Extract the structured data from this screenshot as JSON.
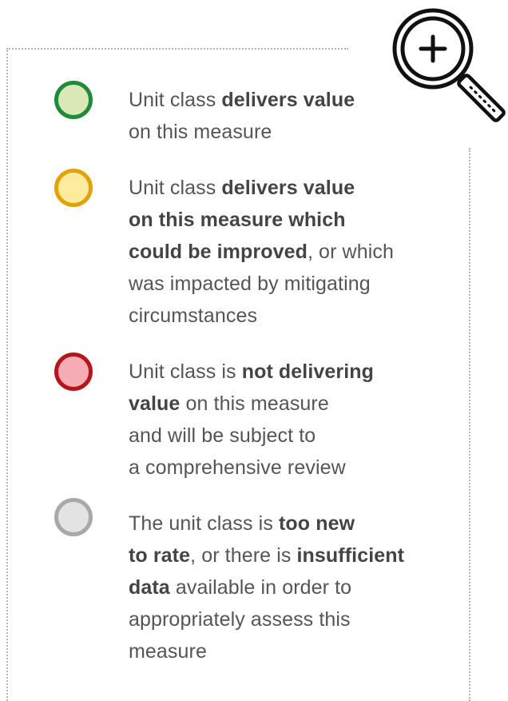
{
  "colors": {
    "green_fill": "#d9e8b5",
    "green_border": "#1f8a3a",
    "yellow_fill": "#fdeb9e",
    "yellow_border": "#e2a30a",
    "red_fill": "#f4adb5",
    "red_border": "#b5161c",
    "gray_fill": "#e3e3e3",
    "gray_border": "#a8a8a8",
    "frame": "#b3b3b3"
  },
  "icons": {
    "zoom": "zoom-in-magnifier-icon"
  },
  "legend": [
    {
      "status": "green",
      "lines": [
        [
          {
            "t": "Unit class ",
            "b": false
          },
          {
            "t": "delivers value",
            "b": true
          }
        ],
        [
          {
            "t": "on this measure",
            "b": false
          }
        ]
      ]
    },
    {
      "status": "yellow",
      "lines": [
        [
          {
            "t": "Unit class ",
            "b": false
          },
          {
            "t": "delivers value",
            "b": true
          }
        ],
        [
          {
            "t": "on this measure which",
            "b": true
          }
        ],
        [
          {
            "t": "could be improved",
            "b": true
          },
          {
            "t": ", or which",
            "b": false
          }
        ],
        [
          {
            "t": "was impacted by mitigating",
            "b": false
          }
        ],
        [
          {
            "t": "circumstances",
            "b": false
          }
        ]
      ]
    },
    {
      "status": "red",
      "lines": [
        [
          {
            "t": "Unit class is ",
            "b": false
          },
          {
            "t": "not delivering",
            "b": true
          }
        ],
        [
          {
            "t": "value",
            "b": true
          },
          {
            "t": " on this measure",
            "b": false
          }
        ],
        [
          {
            "t": "and will be subject to",
            "b": false
          }
        ],
        [
          {
            "t": "a comprehensive review",
            "b": false
          }
        ]
      ]
    },
    {
      "status": "gray",
      "lines": [
        [
          {
            "t": "The unit class is ",
            "b": false
          },
          {
            "t": "too new",
            "b": true
          }
        ],
        [
          {
            "t": "to rate",
            "b": true
          },
          {
            "t": ", or there is ",
            "b": false
          },
          {
            "t": "insufficient",
            "b": true
          }
        ],
        [
          {
            "t": "data",
            "b": true
          },
          {
            "t": " available in order to",
            "b": false
          }
        ],
        [
          {
            "t": "appropriately assess this",
            "b": false
          }
        ],
        [
          {
            "t": "measure",
            "b": false
          }
        ]
      ]
    }
  ]
}
